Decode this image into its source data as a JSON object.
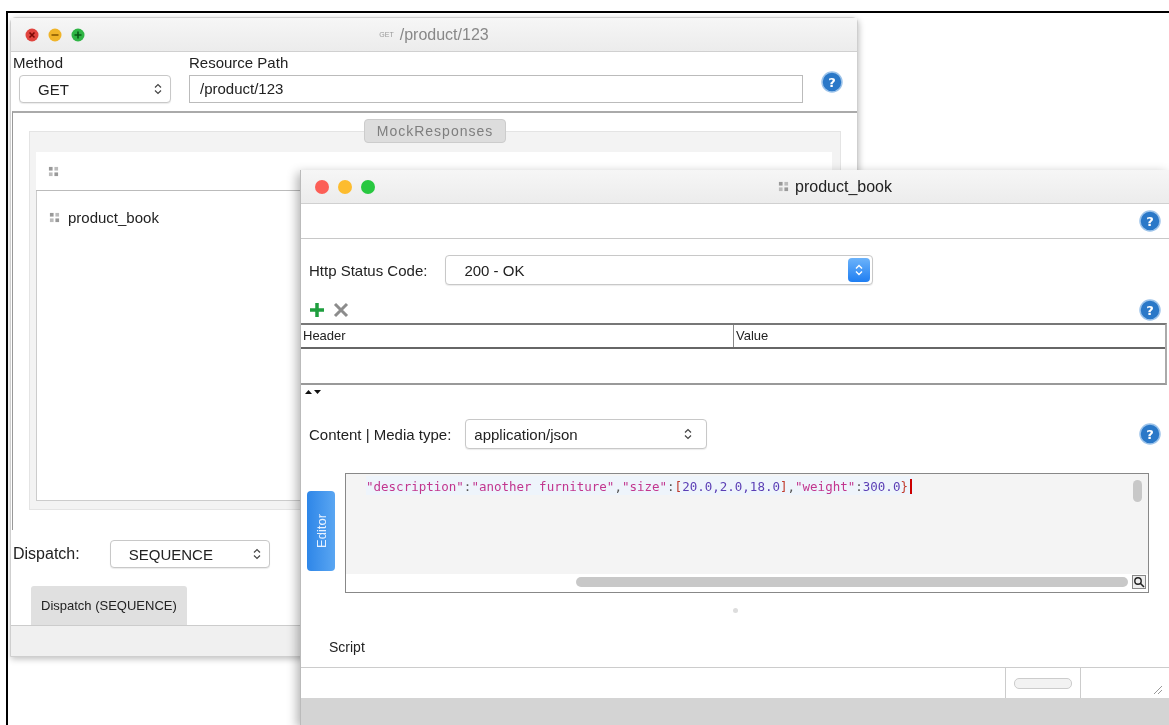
{
  "back_window": {
    "method_badge": "GET",
    "title": "/product/123",
    "method": {
      "label": "Method",
      "value": "GET"
    },
    "resource_path": {
      "label": "Resource Path",
      "value": "/product/123"
    },
    "help_glyph": "?",
    "mock_responses_tab": {
      "label": "MockResponses",
      "disabled": true
    },
    "responses": [
      {
        "name": "product_book",
        "selected": false
      }
    ],
    "dispatch": {
      "label": "Dispatch:",
      "value": "SEQUENCE"
    },
    "dispatch_button": "Dispatch (SEQUENCE)"
  },
  "front_window": {
    "title": "product_book",
    "help_glyphs": [
      "?",
      "?",
      "?"
    ],
    "status_code": {
      "label": "Http Status Code:",
      "value": "200 - OK"
    },
    "headers_table": {
      "columns": [
        "Header",
        "Value"
      ]
    },
    "media_type": {
      "label": "Content | Media type:",
      "value": "application/json"
    },
    "editor_tab": "Editor",
    "editor_tokens": [
      {
        "kind": "key",
        "text": "\"description\""
      },
      {
        "kind": "punct",
        "text": ":"
      },
      {
        "kind": "string",
        "text": "\"another furniture\""
      },
      {
        "kind": "punct",
        "text": ","
      },
      {
        "kind": "key",
        "text": "\"size\""
      },
      {
        "kind": "punct",
        "text": ":"
      },
      {
        "kind": "bracket",
        "text": "["
      },
      {
        "kind": "number",
        "text": "20.0,2.0,18.0"
      },
      {
        "kind": "bracket",
        "text": "]"
      },
      {
        "kind": "punct",
        "text": ","
      },
      {
        "kind": "key",
        "text": "\"weight\""
      },
      {
        "kind": "punct",
        "text": ":"
      },
      {
        "kind": "number",
        "text": "300.0"
      },
      {
        "kind": "bracket",
        "text": "}"
      }
    ],
    "script_label": "Script"
  }
}
